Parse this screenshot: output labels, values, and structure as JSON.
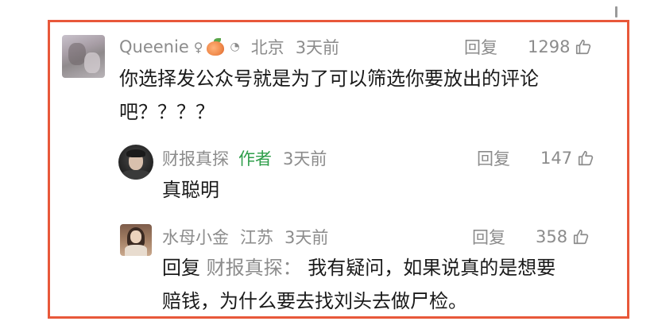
{
  "comments": {
    "main": {
      "username": "Queenie",
      "gender_icon": "female-symbol",
      "badge_icon": "peach-icon",
      "location": "北京",
      "time": "3天前",
      "reply_label": "回复",
      "likes": "1298",
      "text_line1": "你选择发公众号就是为了可以筛选你要放出的评论",
      "text_line2": "吧？？？？"
    },
    "reply1": {
      "username": "财报真探",
      "author_tag": "作者",
      "time": "3天前",
      "reply_label": "回复",
      "likes": "147",
      "text": "真聪明"
    },
    "reply2": {
      "username": "水母小金",
      "location": "江苏",
      "time": "3天前",
      "reply_label": "回复",
      "likes": "358",
      "reply_prefix": "回复",
      "reply_target": "财报真探：",
      "text_line1": "我有疑问，如果说真的是想要",
      "text_line2": "赔钱，为什么要去找刘头去做尸检。"
    }
  },
  "colors": {
    "highlight_border": "#e8583a",
    "meta_gray": "#8c8c8c",
    "author_green": "#2e9e4a",
    "text_dark": "#1a1a1a"
  }
}
